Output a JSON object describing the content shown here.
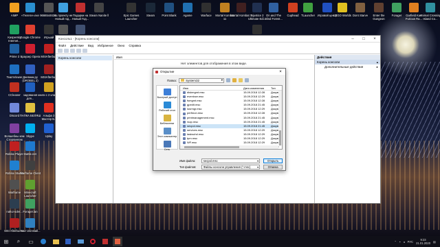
{
  "desktop": {
    "icons": [
      {
        "label": "AIMP",
        "color": "#f0a020"
      },
      {
        "label": "«Телеги».exe",
        "color": "#2a8fd0"
      },
      {
        "label": "9666544634..",
        "color": "#555555"
      },
      {
        "label": "по проекту не Новый год...",
        "color": "#3fa0e0"
      },
      {
        "label": "Подарки на Новый Год...",
        "color": "#c03030"
      },
      {
        "label": "Steam Nanite ll",
        "color": "#444444"
      },
      {
        "label": "Epic Games Launcher",
        "color": "#333333"
      },
      {
        "label": "Steam",
        "color": "#1b2838"
      },
      {
        "label": "Point Blank",
        "color": "#205080"
      },
      {
        "label": "Agame",
        "color": "#2070b0"
      },
      {
        "label": "Warface",
        "color": "#303030"
      },
      {
        "label": "Mortal Kombat 11",
        "color": "#c08020"
      },
      {
        "label": "Mortal Kombat X",
        "color": "#402020"
      },
      {
        "label": "Injustice 2 Ultimate Edi...",
        "color": "#203050"
      },
      {
        "label": "On and The Blind Forest...",
        "color": "#3060a0"
      },
      {
        "label": "Cuphead",
        "color": "#d04020"
      },
      {
        "label": "TLauncher",
        "color": "#40a040"
      },
      {
        "label": "Игровой центр",
        "color": "#2050c0"
      },
      {
        "label": "LEGO Worlds",
        "color": "#e0c020"
      },
      {
        "label": "Dont Starve",
        "color": "#806040"
      },
      {
        "label": "Enter the Gungeon",
        "color": "#604030"
      },
      {
        "label": "Forager",
        "color": "#40a060"
      },
      {
        "label": "Garfield Kart Furious Ra...",
        "color": "#e08020"
      },
      {
        "label": "Animal Crossing Island Co...",
        "color": "#3090a0"
      },
      {
        "label": "Kaspersky Internet...",
        "color": "#20a060"
      },
      {
        "label": "Google Chrome",
        "color": "#e04030"
      },
      {
        "label": "Игрыай",
        "color": "#333333"
      },
      {
        "label": "be2360dce...",
        "color": "#555555"
      },
      {
        "label": "Самолёты и кадры",
        "color": "#405070"
      },
      {
        "label": "Ассасин's Creed IV Bl...",
        "color": "#303030"
      },
      {
        "label": "Prime 3",
        "color": "#2060a0"
      },
      {
        "label": "Браузер Opera",
        "color": "#d02030"
      },
      {
        "label": "MSIAfterbu..",
        "color": "#c02020"
      },
      {
        "label": "TeamViewer",
        "color": "#1e6fc0"
      },
      {
        "label": "Дневник.ру (DROBEL 2)",
        "color": "#3060c0"
      },
      {
        "label": "MSIAfterbu..",
        "color": "#a02020"
      },
      {
        "label": "CCleaner",
        "color": "#c03020"
      },
      {
        "label": "задовання для...",
        "color": "#2060c0"
      },
      {
        "label": "книги с 2 класса",
        "color": "#d0a020"
      },
      {
        "label": "Discord",
        "color": "#7289da"
      },
      {
        "label": "ПАПКА БЕЛЯШ",
        "color": "#e0c040"
      },
      {
        "label": "Альфа 3 Мастер Б..",
        "color": "#e03020"
      },
      {
        "label": "Волшебны кем Стерлингем",
        "color": "#8040a0"
      },
      {
        "label": "Skype",
        "color": "#00aff0"
      },
      {
        "label": "Uplay",
        "color": "#2060d0"
      },
      {
        "label": "Roblox Player",
        "color": "#c02020"
      },
      {
        "label": "Battle.net",
        "color": "#1f7ad0"
      },
      {
        "label": "Roblox Studio",
        "color": "#2080d0"
      },
      {
        "label": "Warframe Client",
        "color": "#404040"
      },
      {
        "label": "Warframe",
        "color": "#505050"
      },
      {
        "label": "Minecraft Launcher",
        "color": "#60a030"
      },
      {
        "label": "nahui-oder...",
        "color": "#2c3e50"
      },
      {
        "label": "Forager.lan",
        "color": "#40a060"
      },
      {
        "label": "MSI Afterburner",
        "color": "#b02020"
      },
      {
        "label": "Your Uninstall...",
        "color": "#3080c0"
      },
      {
        "label": "Bandicam",
        "color": "#205090"
      },
      {
        "label": "нм11orbolo...",
        "color": "#404040"
      }
    ]
  },
  "mmc": {
    "title": "Консоль1 - [Корень консоли]",
    "menu": [
      "Файл",
      "Действие",
      "Вид",
      "Избранное",
      "Окно",
      "Справка"
    ],
    "tree_root": "Корень консоли",
    "center_header": "Имя",
    "empty_message": "Нет элементов для отображения в этом виде.",
    "actions_header": "Действия",
    "actions_subheader": "Корень консоли",
    "actions_item": "Дополнительные действия"
  },
  "dialog": {
    "title": "Открытие",
    "lookin_label": "Папка:",
    "lookin_value": "System32",
    "places": [
      {
        "label": "Быстрый доступ",
        "color": "#3d7fd8"
      },
      {
        "label": "Рабочий стол",
        "color": "#2a8ad6"
      },
      {
        "label": "Библиотеки",
        "color": "#d9b440"
      },
      {
        "label": "Этот компьютер",
        "color": "#5a8fc8"
      },
      {
        "label": "Сеть",
        "color": "#4a78b8"
      }
    ],
    "columns": [
      "Имя",
      "Дата изменения",
      "Тип"
    ],
    "files": [
      {
        "name": "diskmgmt.msc",
        "date": "15.09.2018 12:28",
        "type": "Докум"
      },
      {
        "name": "eventvwr.msc",
        "date": "15.09.2018 12:29",
        "type": "Докум"
      },
      {
        "name": "fsmgmt.msc",
        "date": "15.09.2018 12:28",
        "type": "Докум"
      },
      {
        "name": "gpedit.msc",
        "date": "15.09.2018 21:45",
        "type": "Докум"
      },
      {
        "name": "lusrmgr.msc",
        "date": "15.09.2018 12:29",
        "type": "Докум"
      },
      {
        "name": "perfmon.msc",
        "date": "15.09.2018 12:28",
        "type": "Докум"
      },
      {
        "name": "printmanagement.msc",
        "date": "15.09.2018 21:45",
        "type": "Докум"
      },
      {
        "name": "rsop.msc",
        "date": "15.09.2018 21:45",
        "type": "Докум"
      },
      {
        "name": "secpol.msc",
        "date": "15.09.2018 21:45",
        "type": "Докум"
      },
      {
        "name": "services.msc",
        "date": "15.09.2018 12:29",
        "type": "Докум"
      },
      {
        "name": "taskschd.msc",
        "date": "15.09.2018 12:29",
        "type": "Докум"
      },
      {
        "name": "tpm.msc",
        "date": "15.09.2018 12:29",
        "type": "Докум"
      },
      {
        "name": "WF.msc",
        "date": "15.09.2018 12:29",
        "type": "Докум"
      },
      {
        "name": "WmiMgmt.msc",
        "date": "15.09.2018 12:29",
        "type": "Докум"
      }
    ],
    "selected_index": 8,
    "filename_label": "Имя файла:",
    "filename_value": "secpol.msc",
    "filetype_label": "Тип файлов:",
    "filetype_value": "Файлы консоли управления (*.msc)",
    "open_label": "Открыть",
    "cancel_label": "Отмена"
  },
  "taskbar": {
    "search_glyph": "⌕",
    "task_glyph": "▭",
    "tray_lang": "РУС",
    "time": "9:23",
    "date": "21.01.2020"
  }
}
